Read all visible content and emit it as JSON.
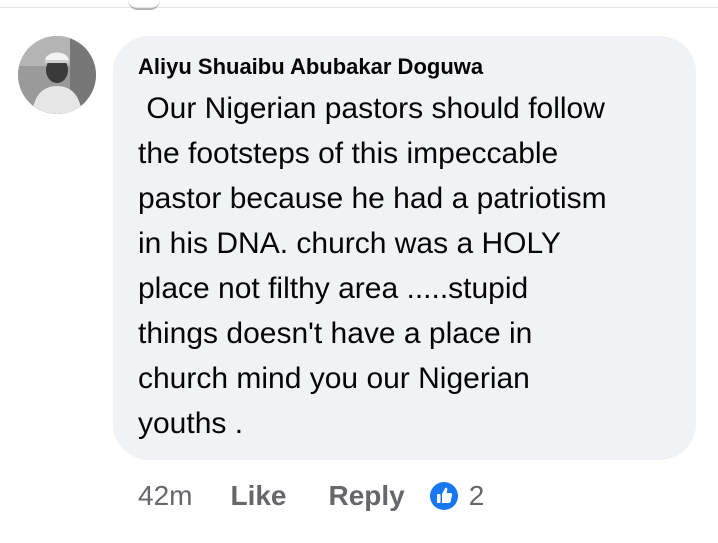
{
  "comment": {
    "author": "Aliyu Shuaibu Abubakar Doguwa",
    "text_lines": [
      " Our Nigerian pastors should follow",
      "the footsteps of this impeccable",
      "pastor because he had a patriotism",
      "in his DNA. church was a HOLY",
      "place not filthy area .....stupid",
      "things doesn't have a place in",
      "church mind you our Nigerian",
      "youths ."
    ],
    "avatar_icon": "profile-photo"
  },
  "actions": {
    "time": "42m",
    "like_label": "Like",
    "reply_label": "Reply",
    "reaction_icon": "like-thumb-icon",
    "reaction_count": "2"
  },
  "colors": {
    "bubble_bg": "#f0f2f5",
    "text": "#050505",
    "meta": "#65676b",
    "like_blue": "#1877f2"
  }
}
